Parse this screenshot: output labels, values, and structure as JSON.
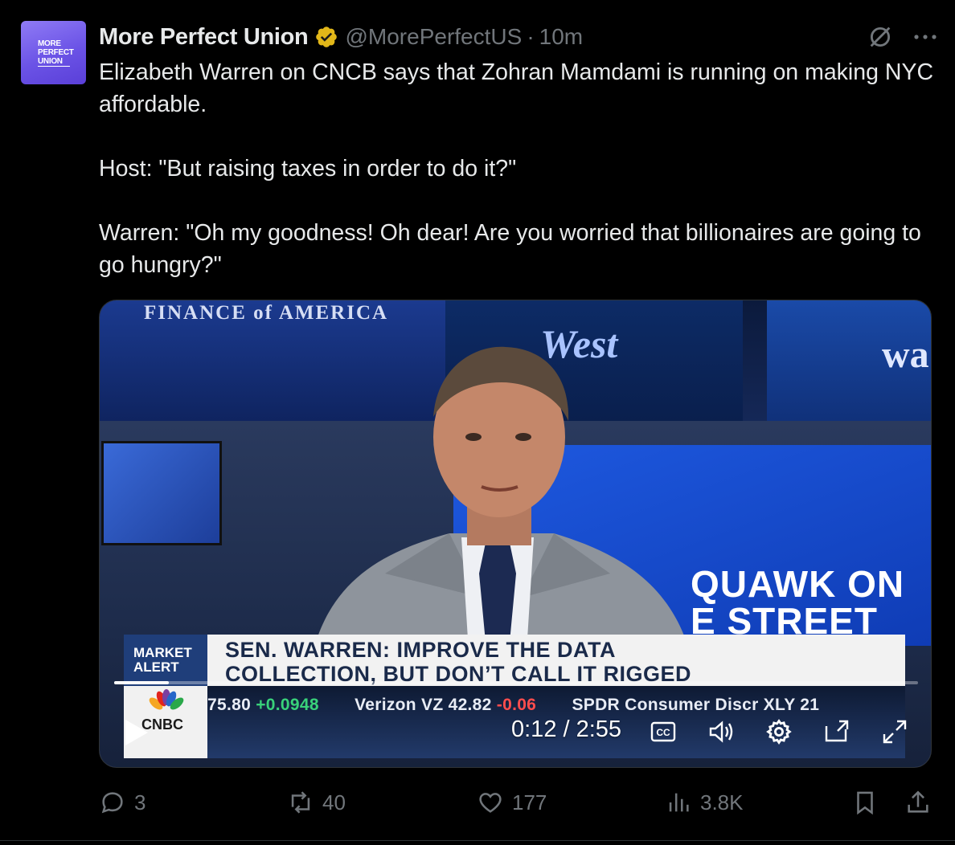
{
  "author": {
    "avatar_lines": [
      "MORE",
      "PERFECT",
      "UNION"
    ],
    "name": "More Perfect Union",
    "handle": "@MorePerfectUS",
    "separator": "·",
    "time": "10m"
  },
  "tweet": {
    "para1": "Elizabeth Warren on CNCB says that Zohran Mamdami is running on making NYC affordable.",
    "para2": "Host: \"But raising taxes in order to do it?\"",
    "para3": "Warren: \"Oh my goodness! Oh dear! Are you worried that billionaires are going to go hungry?\""
  },
  "video": {
    "bg_sign_left": "FINANCE of AMERICA",
    "bg_sign_mid": "West",
    "bg_sign_right": "wa",
    "bg_show": "QUAWK ON",
    "bg_show2": "E STREET",
    "alert_line1": "MARKET",
    "alert_line2": "ALERT",
    "headline_line1": "SEN. WARREN: IMPROVE THE DATA",
    "headline_line2": "COLLECTION, BUT DON’T CALL IT RIGGED",
    "network": "CNBC",
    "ticker": {
      "t1_price": "75.80",
      "t1_change": "+0.0948",
      "t2_name": "Verizon VZ",
      "t2_price": "42.82",
      "t2_change": "-0.06",
      "t3_name": "SPDR Consumer Discr XLY",
      "t3_price": "21"
    },
    "timecode": "0:12 / 2:55",
    "progress_fraction": 0.068
  },
  "actions": {
    "replies": "3",
    "reposts": "40",
    "likes": "177",
    "views": "3.8K"
  },
  "colors": {
    "background": "#000000",
    "text": "#e7e9ea",
    "muted": "#71767b",
    "verified_gold": "#e2b719",
    "avatar_purple": "#6b53e6"
  }
}
